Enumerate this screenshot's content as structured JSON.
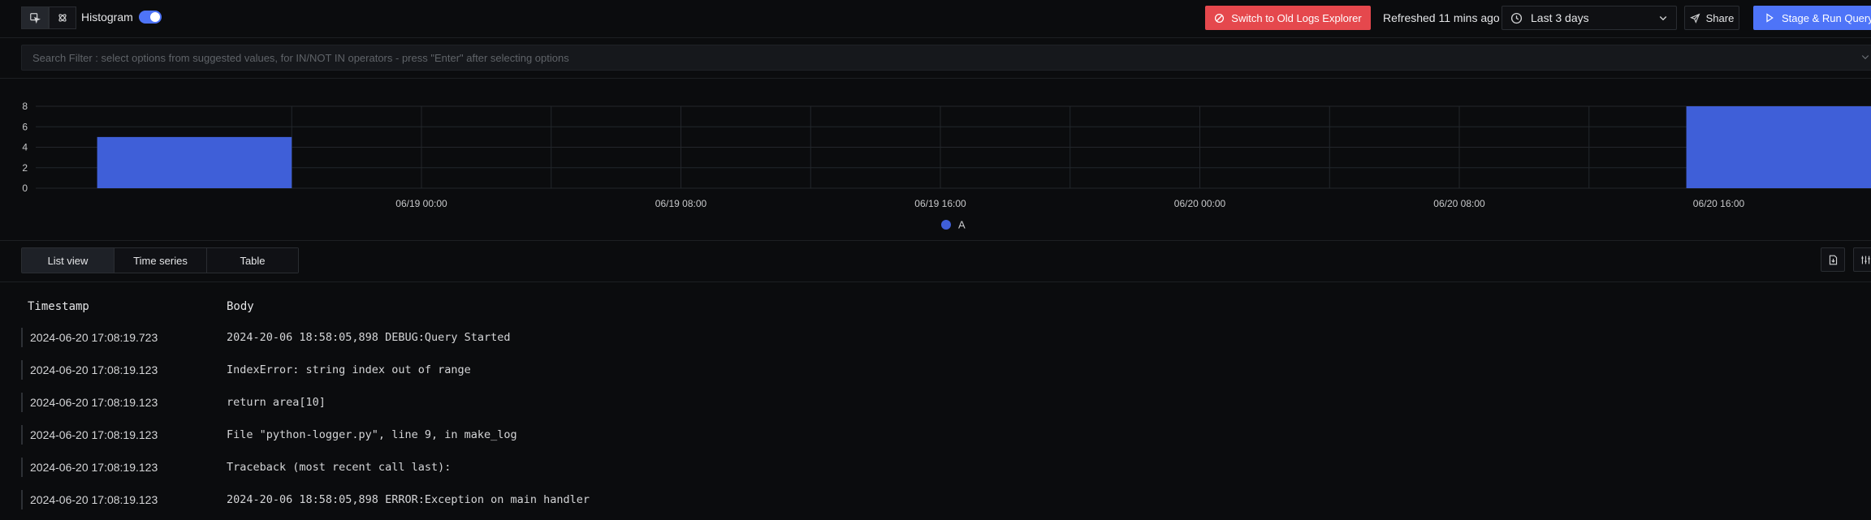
{
  "toolbar": {
    "histogram_label": "Histogram",
    "histogram_enabled": true,
    "switch_old_label": "Switch to Old Logs Explorer",
    "refreshed_label": "Refreshed 11 mins ago",
    "time_range": "Last 3 days",
    "share_label": "Share",
    "run_label": "Stage & Run Query"
  },
  "search": {
    "placeholder": "Search Filter : select options from suggested values, for IN/NOT IN operators - press \"Enter\" after selecting options"
  },
  "chart_data": {
    "type": "bar",
    "x_ticks": [
      "06/19 00:00",
      "06/19 08:00",
      "06/19 16:00",
      "06/20 00:00",
      "06/20 08:00",
      "06/20 16:00"
    ],
    "y_ticks": [
      0,
      2,
      4,
      6,
      8
    ],
    "ylim": [
      0,
      8
    ],
    "series": [
      {
        "name": "A",
        "color": "#3f5fd8",
        "bars": [
          {
            "start": "06/18 14:00",
            "end": "06/18 20:00",
            "value": 5
          },
          {
            "start": "06/20 15:00",
            "end": "06/20 21:00",
            "value": 8
          }
        ]
      }
    ],
    "legend_position": "bottom",
    "grid": true
  },
  "views": {
    "tabs": [
      {
        "label": "List view",
        "active": true
      },
      {
        "label": "Time series",
        "active": false
      },
      {
        "label": "Table",
        "active": false
      }
    ]
  },
  "logs": {
    "columns": [
      "Timestamp",
      "Body"
    ],
    "rows": [
      {
        "timestamp": "2024-06-20 17:08:19.723",
        "body": "2024-20-06 18:58:05,898 DEBUG:Query Started"
      },
      {
        "timestamp": "2024-06-20 17:08:19.123",
        "body": "IndexError: string index out of range"
      },
      {
        "timestamp": "2024-06-20 17:08:19.123",
        "body": "return area[10]"
      },
      {
        "timestamp": "2024-06-20 17:08:19.123",
        "body": "File \"python-logger.py\", line 9, in make_log"
      },
      {
        "timestamp": "2024-06-20 17:08:19.123",
        "body": "Traceback (most recent call last):"
      },
      {
        "timestamp": "2024-06-20 17:08:19.123",
        "body": "2024-20-06 18:58:05,898 ERROR:Exception on main handler"
      }
    ]
  },
  "colors": {
    "accent": "#4e74f8",
    "danger": "#e5484d",
    "background": "#0b0c0e"
  }
}
